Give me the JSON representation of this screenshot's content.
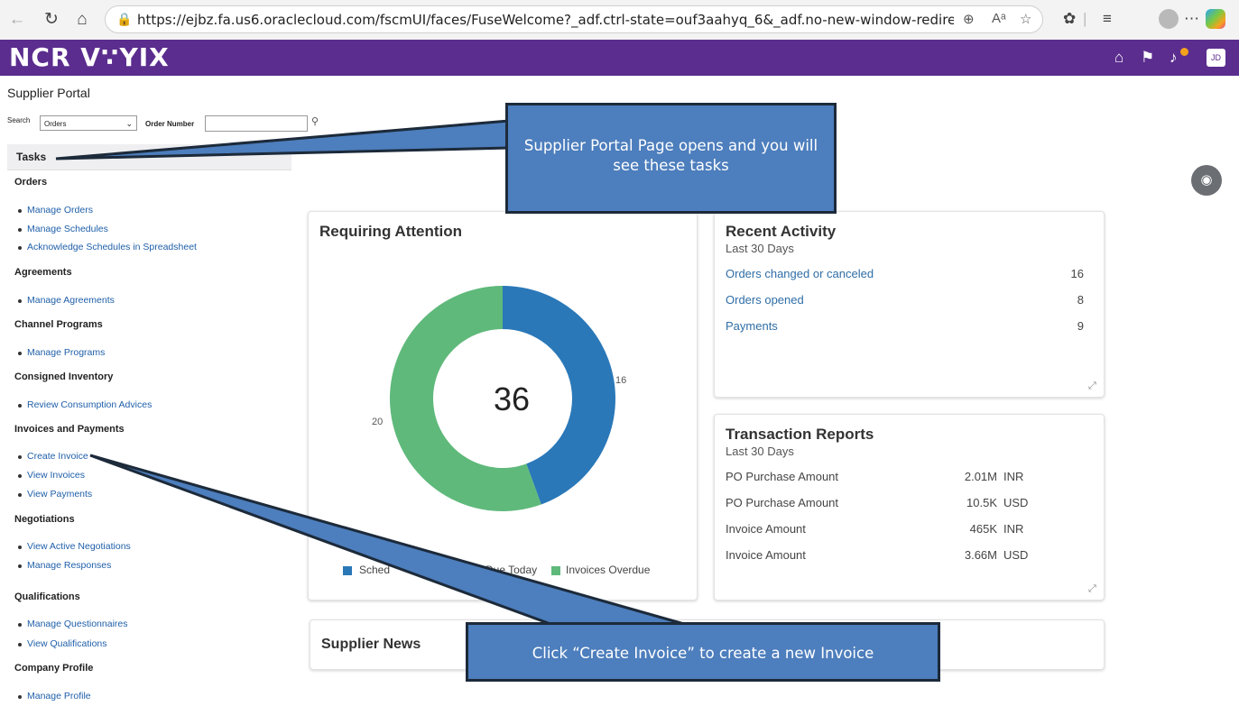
{
  "browser": {
    "url": "https://ejbz.fa.us6.oraclecloud.com/fscmUI/faces/FuseWelcome?_adf.ctrl-state=ouf3aahyq_6&_adf.no-new-window-redirect=true&_a...",
    "read_aloud_icon": "Aᵃ"
  },
  "header": {
    "logo": "NCR V∵YIX",
    "avatar_initials": "JD",
    "notification_count": "1"
  },
  "page": {
    "title": "Supplier Portal",
    "search_label": "Search",
    "search_value": "Orders",
    "order_number_label": "Order Number"
  },
  "tasks": {
    "title": "Tasks",
    "groups": [
      {
        "name": "Orders",
        "items": [
          "Manage Orders",
          "Manage Schedules",
          "Acknowledge Schedules in Spreadsheet"
        ]
      },
      {
        "name": "Agreements",
        "items": [
          "Manage Agreements"
        ]
      },
      {
        "name": "Channel Programs",
        "items": [
          "Manage Programs"
        ]
      },
      {
        "name": "Consigned Inventory",
        "items": [
          "Review Consumption Advices"
        ]
      },
      {
        "name": "Invoices and Payments",
        "items": [
          "Create Invoice",
          "View Invoices",
          "View Payments"
        ]
      },
      {
        "name": "Negotiations",
        "items": [
          "View Active Negotiations",
          "Manage Responses"
        ]
      },
      {
        "name": "Qualifications",
        "items": [
          "Manage Questionnaires",
          "View Qualifications"
        ]
      },
      {
        "name": "Company Profile",
        "items": [
          "Manage Profile"
        ]
      }
    ]
  },
  "requiring_attention": {
    "title": "Requiring Attention",
    "total": "36",
    "label_green": "20",
    "label_blue": "16",
    "legend": [
      "Sched",
      "Due Today",
      "Invoices Overdue"
    ],
    "colors": {
      "blue": "#2a78b8",
      "green": "#5fb97b"
    }
  },
  "chart_data": {
    "type": "pie",
    "title": "Requiring Attention",
    "center_label": "36",
    "categories": [
      "Scheduled (partially obscured)",
      "Invoices Overdue"
    ],
    "values": [
      16,
      20
    ]
  },
  "recent_activity": {
    "title": "Recent Activity",
    "subtitle": "Last 30 Days",
    "rows": [
      {
        "label": "Orders changed or canceled",
        "count": "16"
      },
      {
        "label": "Orders opened",
        "count": "8"
      },
      {
        "label": "Payments",
        "count": "9"
      }
    ]
  },
  "transaction_reports": {
    "title": "Transaction Reports",
    "subtitle": "Last 30 Days",
    "rows": [
      {
        "label": "PO Purchase Amount",
        "value": "2.01M",
        "currency": "INR"
      },
      {
        "label": "PO Purchase Amount",
        "value": "10.5K",
        "currency": "USD"
      },
      {
        "label": "Invoice Amount",
        "value": "465K",
        "currency": "INR"
      },
      {
        "label": "Invoice Amount",
        "value": "3.66M",
        "currency": "USD"
      }
    ]
  },
  "supplier_news": {
    "title": "Supplier News"
  },
  "callouts": {
    "tasks": "Supplier Portal Page opens and you will see these tasks",
    "create_invoice": "Click “Create Invoice” to create a new Invoice"
  }
}
